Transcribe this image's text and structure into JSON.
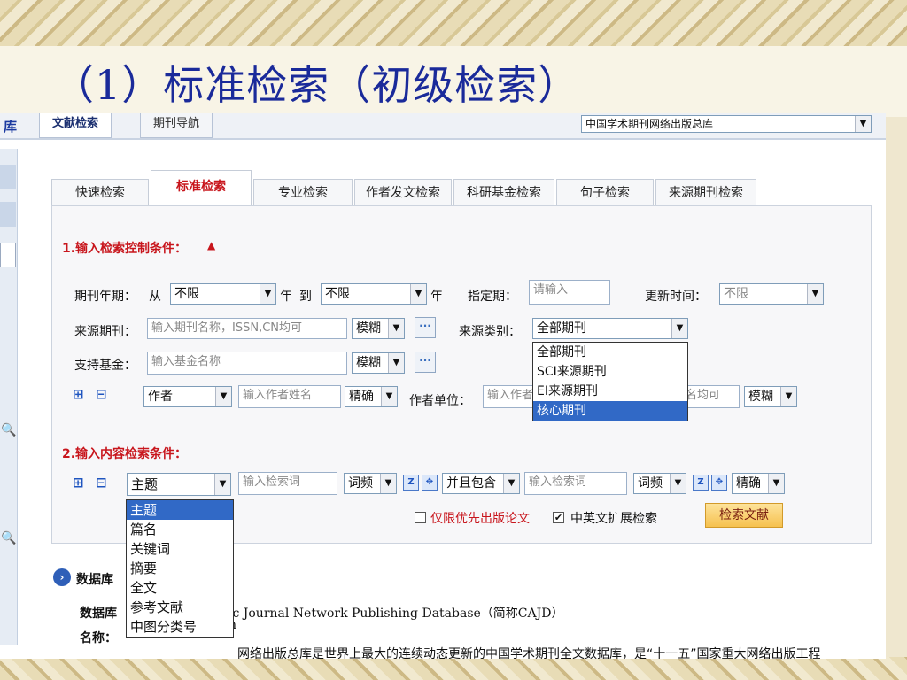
{
  "slide_title": "（1）标准检索（初级检索）",
  "top_strip": {
    "lib_char": "库",
    "tabs": [
      "文献检索",
      "期刊导航"
    ],
    "db_select": "中国学术期刊网络出版总库"
  },
  "tabs": [
    "快速检索",
    "标准检索",
    "专业检索",
    "作者发文检索",
    "科研基金检索",
    "句子检索",
    "来源期刊检索"
  ],
  "section1": {
    "title": "1.输入检索控制条件：",
    "year_label": "期刊年期：",
    "from": "从",
    "year_from": "不限",
    "year_word": "年",
    "to": "到",
    "year_to": "不限",
    "year_word2": "年",
    "specified_label": "指定期：",
    "specified_placeholder": "请输入",
    "update_label": "更新时间：",
    "update_value": "不限",
    "source_label": "来源期刊：",
    "source_placeholder": "输入期刊名称，ISSN,CN均可",
    "source_match": "模糊",
    "source_type_label": "来源类别：",
    "source_type_value": "全部期刊",
    "source_type_options": [
      "全部期刊",
      "SCI来源期刊",
      "EI来源期刊",
      "核心期刊"
    ],
    "fund_label": "支持基金：",
    "fund_placeholder": "输入基金名称",
    "fund_match": "模糊",
    "author_field": "作者",
    "author_placeholder": "输入作者姓名",
    "author_match": "精确",
    "unit_label": "作者单位：",
    "unit_placeholder": "输入作者",
    "unit_tail": "名均可",
    "unit_match": "模糊",
    "plus": "⊞",
    "minus": "⊟"
  },
  "section2": {
    "title": "2.输入内容检索条件：",
    "field": "主题",
    "field_options": [
      "主题",
      "篇名",
      "关键词",
      "摘要",
      "全文",
      "参考文献",
      "中图分类号"
    ],
    "term1_placeholder": "输入检索词",
    "freq1": "词频",
    "logic": "并且包含",
    "term2_placeholder": "输入检索词",
    "freq2": "词频",
    "match": "精确",
    "priority_label": "仅限优先出版论文",
    "expand_label": "中英文扩展检索",
    "search_button": "检索文献"
  },
  "info": {
    "db_label": "数据库",
    "en_label": "数据库",
    "en_text": "ic Journal Network Publishing Database（简称CAJD）",
    "name_label": "名称：",
    "name_tail": "n",
    "desc": "网络出版总库是世界上最大的连续动态更新的中国学术期刊全文数据库，是“十一五”国家重大网络出版工程"
  }
}
